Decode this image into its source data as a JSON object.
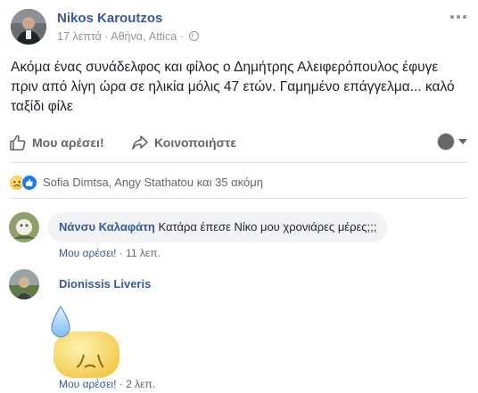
{
  "post": {
    "author": "Nikos Karoutzos",
    "time": "17 λεπτά",
    "separator": "·",
    "location": "Αθήνα, Attica",
    "text": "Ακόμα ένας συνάδελφος και φίλος ο Δημήτρης Αλειφερόπουλος έφυγε πριν από λίγη ώρα σε ηλικία μόλις 47 ετών. Γαμημένο επάγγελμα... καλό ταξίδι φίλε",
    "privacy_icon": "globe-icon",
    "more_icon": "more-options-icon"
  },
  "actions": {
    "like_label": "Μου αρέσει!",
    "share_label": "Κοινοποιήστε"
  },
  "reactions": {
    "icons": [
      "sad-reaction-icon",
      "like-reaction-icon"
    ],
    "summary": "Sofia Dimtsa, Angy Stathatou και 35 ακόμη"
  },
  "comments": [
    {
      "author": "Νάνσυ Καλαφάτη",
      "text": "Κατάρα έπεσε Νίκο μου χρονιάρες μέρες;;;",
      "like_label": "Μου αρέσει!",
      "separator": "·",
      "time": "11 λεπ."
    },
    {
      "author": "Dionissis Liveris",
      "sticker": "sad-sweat-sticker",
      "like_label": "Μου αρέσει!",
      "separator": "·",
      "time": "2 λεπ."
    }
  ],
  "colors": {
    "link": "#385898",
    "meta": "#90949c",
    "action": "#606770",
    "bubble": "#f2f3f5",
    "like_blue": "#1877f2",
    "sad_yellow": "#f4b92d"
  }
}
